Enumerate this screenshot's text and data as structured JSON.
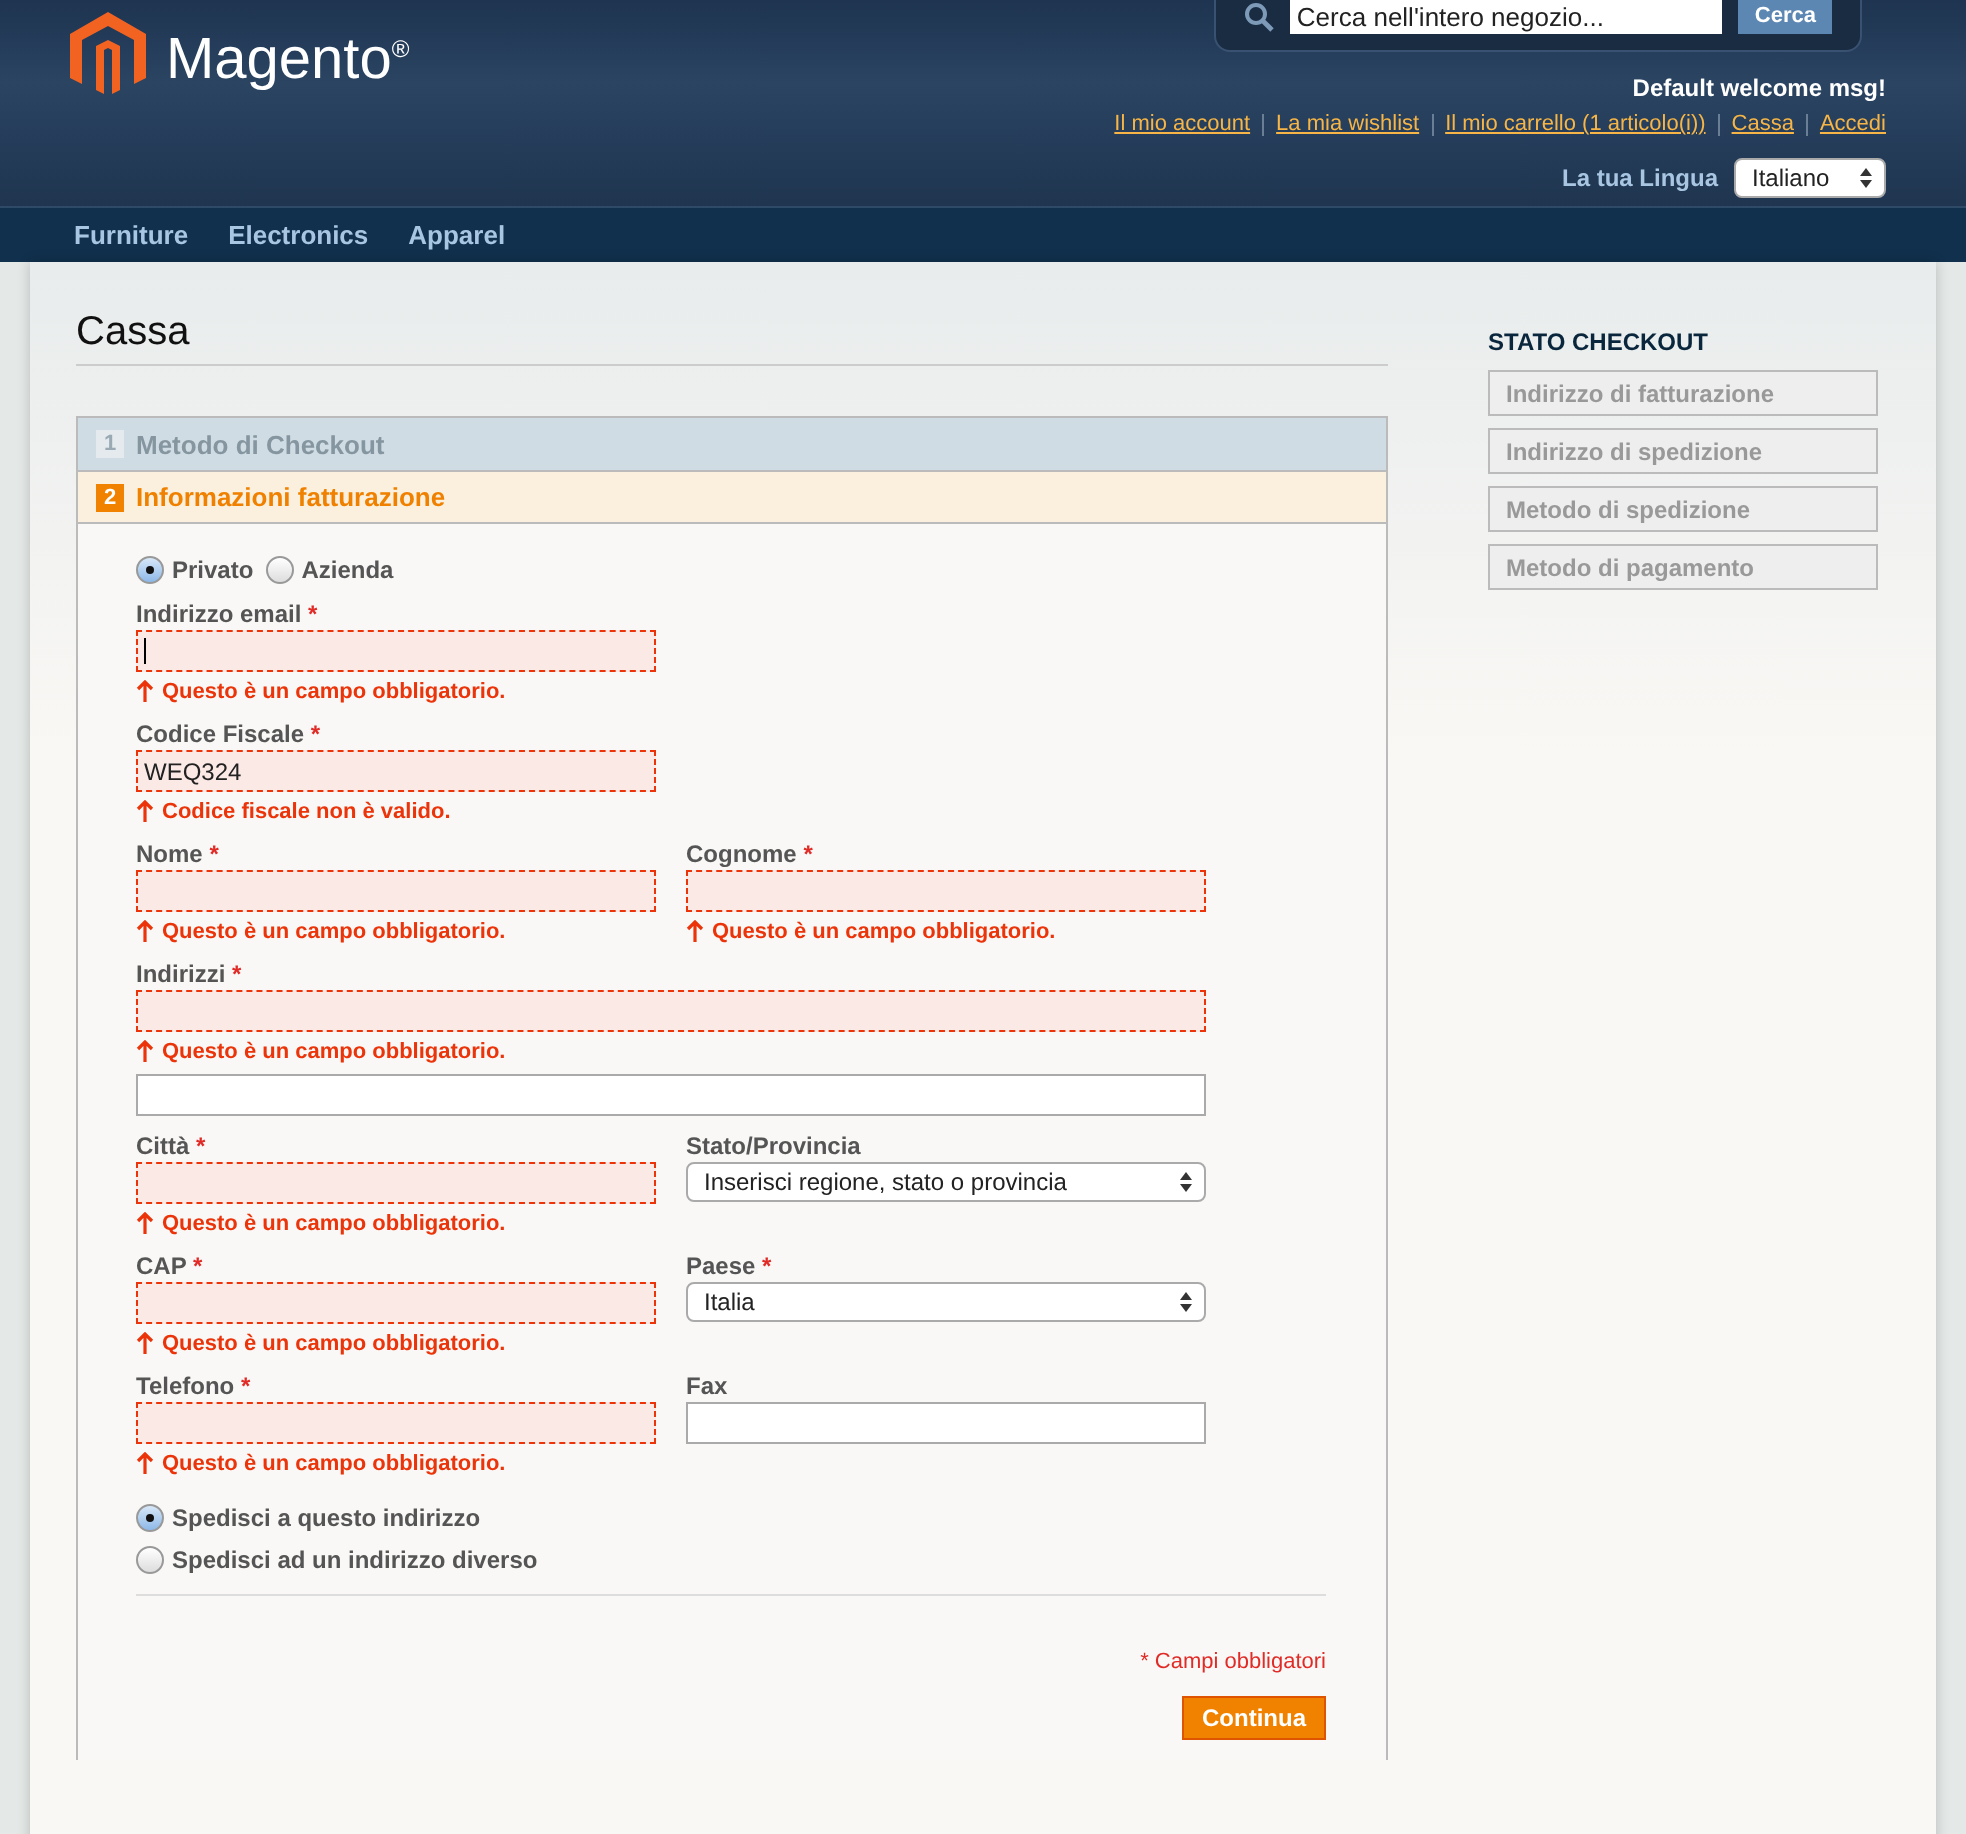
{
  "header": {
    "logo": "Magento",
    "logo_mark": "®",
    "search": {
      "placeholder": "Cerca nell'intero negozio...",
      "button": "Cerca"
    },
    "welcome": "Default welcome msg!",
    "links": [
      "Il mio account",
      "La mia wishlist",
      "Il mio carrello (1 articolo(i))",
      "Cassa",
      "Accedi"
    ],
    "language": {
      "label": "La tua Lingua",
      "value": "Italiano"
    }
  },
  "nav": [
    "Furniture",
    "Electronics",
    "Apparel"
  ],
  "page_title": "Cassa",
  "steps": [
    {
      "number": "1",
      "title": "Metodo di Checkout",
      "selected": false
    },
    {
      "number": "2",
      "title": "Informazioni fatturazione",
      "selected": true
    }
  ],
  "customer_type": [
    {
      "label": "Privato",
      "selected": true
    },
    {
      "label": "Azienda",
      "selected": false
    }
  ],
  "rows": [
    {
      "fields": [
        {
          "kind": "text",
          "label": "Indirizzo email",
          "mark": "*",
          "focused": true,
          "error": "Questo è un campo obbligatorio."
        }
      ]
    },
    {
      "fields": [
        {
          "kind": "text",
          "label": "Codice Fiscale",
          "mark": "*",
          "value": "WEQ324",
          "error": "Codice fiscale non è valido."
        }
      ]
    },
    {
      "fields": [
        {
          "kind": "text",
          "label": "Nome",
          "mark": "*",
          "error": "Questo è un campo obbligatorio."
        },
        {
          "kind": "text",
          "label": "Cognome",
          "mark": "*",
          "error": "Questo è un campo obbligatorio."
        }
      ]
    },
    {
      "fields": [
        {
          "kind": "wide",
          "label": "Indirizzi",
          "mark": "*",
          "error": "Questo è un campo obbligatorio."
        }
      ]
    },
    {
      "fields": [
        {
          "kind": "wide"
        }
      ]
    },
    {
      "fields": [
        {
          "kind": "text",
          "label": "Città",
          "mark": "*",
          "error": "Questo è un campo obbligatorio."
        },
        {
          "kind": "select",
          "label": "Stato/Provincia",
          "value": "Inserisci regione, stato o provincia"
        }
      ]
    },
    {
      "fields": [
        {
          "kind": "text",
          "label": "CAP",
          "mark": "*",
          "error": "Questo è un campo obbligatorio."
        },
        {
          "kind": "select",
          "label": "Paese",
          "mark": "*",
          "value": "Italia"
        }
      ]
    },
    {
      "fields": [
        {
          "kind": "text",
          "label": "Telefono",
          "mark": "*",
          "error": "Questo è un campo obbligatorio."
        },
        {
          "kind": "text",
          "label": "Fax"
        }
      ]
    }
  ],
  "shipping": [
    {
      "label": "Spedisci a questo indirizzo",
      "selected": true
    },
    {
      "label": "Spedisci ad un indirizzo diverso",
      "selected": false
    }
  ],
  "required_note": "* Campi obbligatori",
  "continue_button": "Continua",
  "sidebar": {
    "title": "STATO CHECKOUT",
    "items": [
      "Indirizzo di fatturazione",
      "Indirizzo di spedizione",
      "Metodo di spedizione",
      "Metodo di pagamento"
    ]
  }
}
